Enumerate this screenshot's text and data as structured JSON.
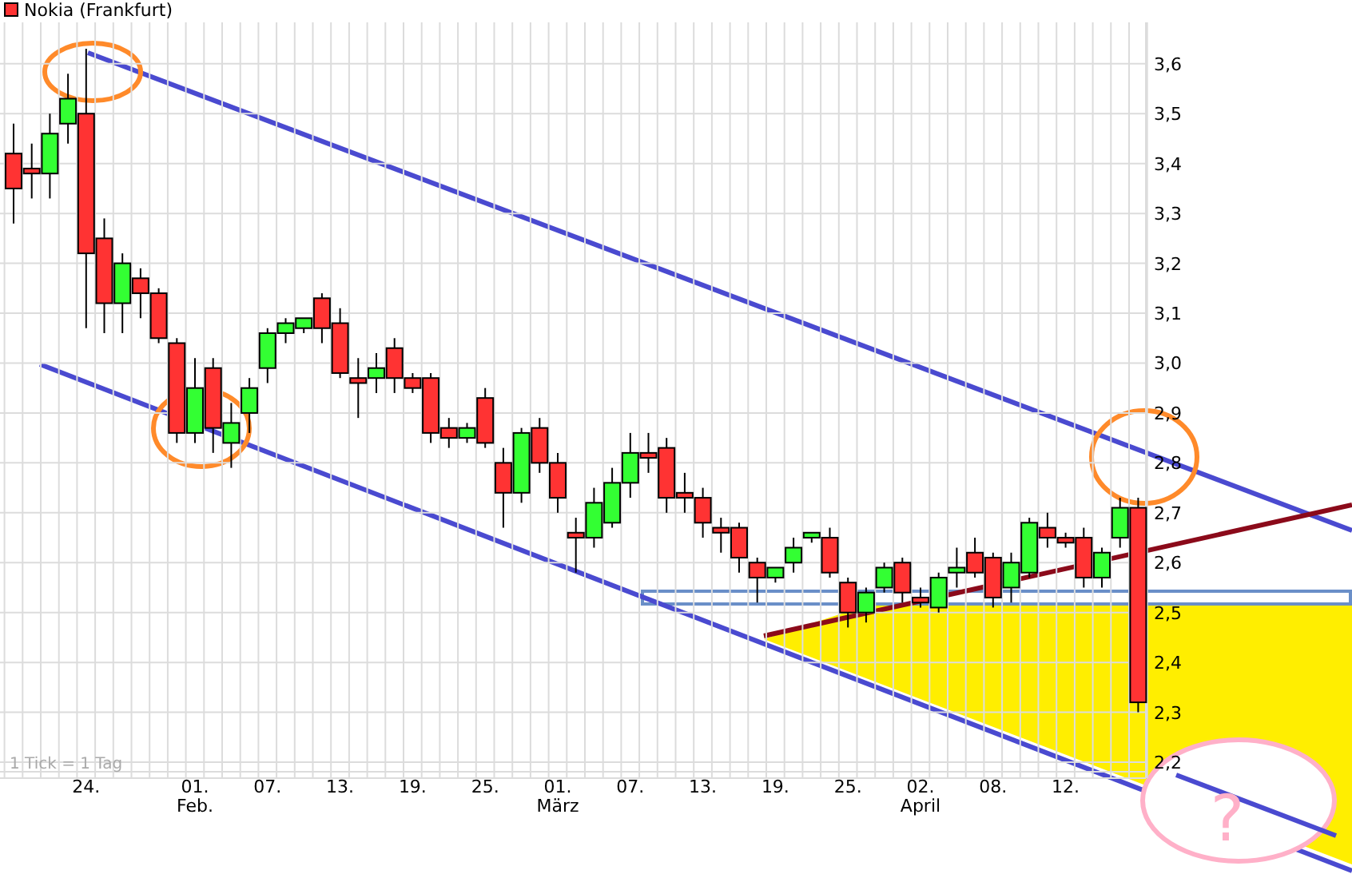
{
  "chart_data": {
    "type": "candlestick",
    "grid": true,
    "ylim": [
      2.168,
      3.683
    ],
    "categories": [
      null,
      null,
      null,
      null,
      "24.",
      null,
      null,
      null,
      null,
      null,
      "01. Feb.",
      null,
      null,
      null,
      "07.",
      null,
      null,
      null,
      "13.",
      null,
      null,
      null,
      "19.",
      null,
      null,
      null,
      "25.",
      null,
      null,
      null,
      "01. März",
      null,
      null,
      null,
      "07.",
      null,
      null,
      null,
      "13.",
      null,
      null,
      null,
      "19.",
      null,
      null,
      null,
      "25.",
      null,
      null,
      null,
      "02. April",
      null,
      null,
      null,
      "08.",
      null,
      null,
      null,
      "12.",
      null,
      null,
      null,
      null
    ],
    "series": [
      {
        "name": "Nokia (Frankfurt)",
        "ohlc": [
          [
            3.42,
            3.48,
            3.28,
            3.35
          ],
          [
            3.39,
            3.44,
            3.33,
            3.38
          ],
          [
            3.38,
            3.5,
            3.33,
            3.46
          ],
          [
            3.48,
            3.58,
            3.44,
            3.53
          ],
          [
            3.5,
            3.63,
            3.07,
            3.22
          ],
          [
            3.25,
            3.29,
            3.06,
            3.12
          ],
          [
            3.12,
            3.22,
            3.06,
            3.2
          ],
          [
            3.17,
            3.19,
            3.09,
            3.14
          ],
          [
            3.14,
            3.15,
            3.04,
            3.05
          ],
          [
            3.04,
            3.05,
            2.84,
            2.86
          ],
          [
            2.86,
            3.01,
            2.84,
            2.95
          ],
          [
            2.99,
            3.01,
            2.82,
            2.87
          ],
          [
            2.84,
            2.92,
            2.79,
            2.88
          ],
          [
            2.9,
            2.97,
            2.86,
            2.95
          ],
          [
            2.99,
            3.07,
            2.96,
            3.06
          ],
          [
            3.06,
            3.09,
            3.04,
            3.08
          ],
          [
            3.07,
            3.09,
            3.06,
            3.09
          ],
          [
            3.13,
            3.14,
            3.04,
            3.07
          ],
          [
            3.08,
            3.11,
            2.97,
            2.98
          ],
          [
            2.97,
            3.01,
            2.89,
            2.96
          ],
          [
            2.97,
            3.02,
            2.94,
            2.99
          ],
          [
            3.03,
            3.05,
            2.94,
            2.97
          ],
          [
            2.97,
            2.98,
            2.94,
            2.95
          ],
          [
            2.97,
            2.98,
            2.84,
            2.86
          ],
          [
            2.87,
            2.89,
            2.83,
            2.85
          ],
          [
            2.85,
            2.88,
            2.84,
            2.87
          ],
          [
            2.93,
            2.95,
            2.83,
            2.84
          ],
          [
            2.8,
            2.83,
            2.67,
            2.74
          ],
          [
            2.74,
            2.87,
            2.72,
            2.86
          ],
          [
            2.87,
            2.89,
            2.78,
            2.8
          ],
          [
            2.8,
            2.82,
            2.7,
            2.73
          ],
          [
            2.66,
            2.69,
            2.58,
            2.65
          ],
          [
            2.65,
            2.75,
            2.63,
            2.72
          ],
          [
            2.68,
            2.79,
            2.67,
            2.76
          ],
          [
            2.76,
            2.86,
            2.73,
            2.82
          ],
          [
            2.82,
            2.86,
            2.78,
            2.81
          ],
          [
            2.83,
            2.85,
            2.7,
            2.73
          ],
          [
            2.74,
            2.78,
            2.7,
            2.73
          ],
          [
            2.73,
            2.75,
            2.65,
            2.68
          ],
          [
            2.67,
            2.69,
            2.62,
            2.66
          ],
          [
            2.67,
            2.68,
            2.58,
            2.61
          ],
          [
            2.6,
            2.61,
            2.52,
            2.57
          ],
          [
            2.57,
            2.59,
            2.56,
            2.59
          ],
          [
            2.6,
            2.65,
            2.58,
            2.63
          ],
          [
            2.65,
            2.66,
            2.64,
            2.66
          ],
          [
            2.65,
            2.67,
            2.57,
            2.58
          ],
          [
            2.56,
            2.57,
            2.47,
            2.5
          ],
          [
            2.5,
            2.55,
            2.48,
            2.54
          ],
          [
            2.55,
            2.6,
            2.54,
            2.59
          ],
          [
            2.6,
            2.61,
            2.52,
            2.54
          ],
          [
            2.53,
            2.55,
            2.51,
            2.52
          ],
          [
            2.51,
            2.58,
            2.5,
            2.57
          ],
          [
            2.58,
            2.63,
            2.55,
            2.59
          ],
          [
            2.62,
            2.65,
            2.57,
            2.58
          ],
          [
            2.61,
            2.62,
            2.51,
            2.53
          ],
          [
            2.55,
            2.62,
            2.52,
            2.6
          ],
          [
            2.58,
            2.69,
            2.57,
            2.68
          ],
          [
            2.67,
            2.7,
            2.63,
            2.65
          ],
          [
            2.65,
            2.66,
            2.63,
            2.64
          ],
          [
            2.65,
            2.67,
            2.55,
            2.57
          ],
          [
            2.57,
            2.63,
            2.55,
            2.62
          ],
          [
            2.65,
            2.73,
            2.63,
            2.71
          ],
          [
            2.71,
            2.73,
            2.3,
            2.32
          ]
        ]
      }
    ],
    "yticks": [
      {
        "value": 3.6,
        "label": "3,6"
      },
      {
        "value": 3.5,
        "label": "3,5"
      },
      {
        "value": 3.4,
        "label": "3,4"
      },
      {
        "value": 3.3,
        "label": "3,3"
      },
      {
        "value": 3.2,
        "label": "3,2"
      },
      {
        "value": 3.1,
        "label": "3,1"
      },
      {
        "value": 3.0,
        "label": "3,0"
      },
      {
        "value": 2.9,
        "label": "2,9"
      },
      {
        "value": 2.8,
        "label": "2,8"
      },
      {
        "value": 2.7,
        "label": "2,7"
      },
      {
        "value": 2.6,
        "label": "2,6"
      },
      {
        "value": 2.5,
        "label": "2,5"
      },
      {
        "value": 2.4,
        "label": "2,4"
      },
      {
        "value": 2.3,
        "label": "2,3"
      },
      {
        "value": 2.2,
        "label": "2,2"
      }
    ],
    "annotations": [
      {
        "text": "1 Tick = 1 Tag"
      },
      {
        "text": "?"
      }
    ]
  }
}
